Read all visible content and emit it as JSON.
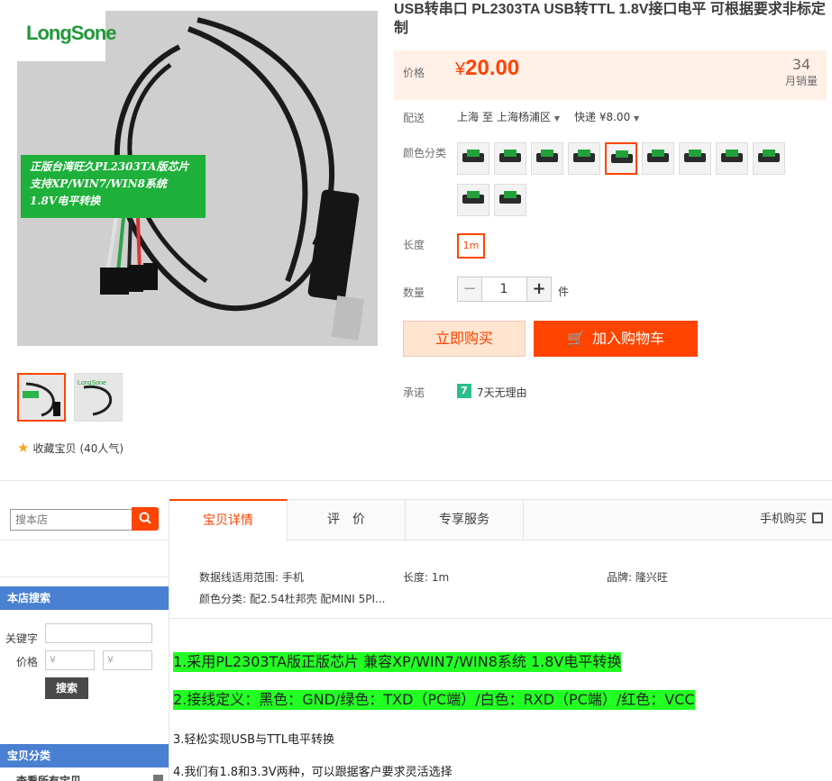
{
  "product": {
    "title": "USB转串口 PL2303TA USB转TTL 1.8V接口电平 可根据要求非标定制",
    "image": {
      "logo_text": "LongSone",
      "label_lines": [
        "正版台湾旺久PL2303TA版芯片",
        "支持XP/WIN7/WIN8系统",
        "1.8V电平转换"
      ]
    },
    "favorite": {
      "label": "收藏宝贝",
      "count": "(40人气)"
    }
  },
  "price": {
    "label": "价格",
    "symbol": "¥",
    "value": "20.00",
    "sales_count": "34",
    "sales_label": "月销量"
  },
  "shipping": {
    "label": "配送",
    "from": "上海",
    "to_word": "至",
    "to": "上海杨浦区",
    "method": "快递 ¥8.00"
  },
  "color": {
    "label": "颜色分类"
  },
  "length": {
    "label": "长度",
    "option": "1m"
  },
  "quantity": {
    "label": "数量",
    "value": "1",
    "minus": "−",
    "plus": "+",
    "unit": "件"
  },
  "actions": {
    "buy_now": "立即购买",
    "add_to_cart": "加入购物车"
  },
  "promise": {
    "label": "承诺",
    "badge": "7",
    "text": "7天无理由"
  },
  "shop_search": {
    "placeholder": "搜本店",
    "panel_title": "本店搜索",
    "keyword_label": "关键字",
    "price_label": "价格",
    "price_min_placeholder": "¥",
    "price_max_placeholder": "¥",
    "button": "搜索"
  },
  "categories": {
    "title": "宝贝分类",
    "first_item": "查看所有宝贝"
  },
  "tabs": {
    "items": [
      "宝贝详情",
      "评　价",
      "专享服务"
    ],
    "mobile_buy": "手机购买"
  },
  "attributes": {
    "scope": "数据线适用范围: 手机",
    "length": "长度: 1m",
    "brand": "品牌: 隆兴旺",
    "color": "颜色分类: 配2.54杜邦壳 配MINI 5PI..."
  },
  "description": {
    "line1": "1.采用PL2303TA版正版芯片 兼容XP/WIN7/WIN8系统  1.8V电平转换 ",
    "line2": "2.接线定义：黑色：GND/绿色：TXD（PC端）/白色：RXD（PC端）/红色：VCC",
    "line3": "3.轻松实现USB与TTL电平转换",
    "line4": "4.我们有1.8和3.3V两种，可以跟据客户要求灵活选择"
  },
  "colors": {
    "accent": "#ff4400",
    "price_bg": "#fff0e8",
    "panel_blue": "#4a80d1",
    "highlight_green": "#22ff22"
  }
}
